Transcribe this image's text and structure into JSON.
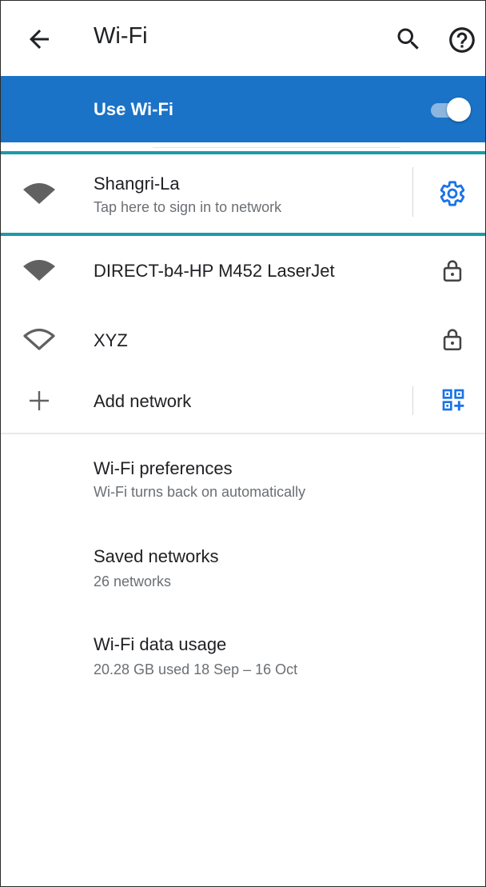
{
  "header": {
    "title": "Wi-Fi"
  },
  "toggle": {
    "label": "Use Wi-Fi",
    "enabled": true
  },
  "networks": [
    {
      "name": "Shangri-La",
      "status": "Tap here to sign in to network",
      "signal_icon": "wifi-full-icon",
      "action_icon": "gear-icon"
    },
    {
      "name": "DIRECT-b4-HP M452 LaserJet",
      "signal_icon": "wifi-full-icon",
      "action_icon": "lock-icon"
    },
    {
      "name": "XYZ",
      "signal_icon": "wifi-outline-icon",
      "action_icon": "lock-icon"
    }
  ],
  "add_network": {
    "label": "Add network",
    "icon": "plus-icon",
    "action_icon": "qr-code-scan-icon"
  },
  "settings": [
    {
      "title": "Wi-Fi preferences",
      "summary": "Wi-Fi turns back on automatically"
    },
    {
      "title": "Saved networks",
      "summary": "26 networks"
    },
    {
      "title": "Wi-Fi data usage",
      "summary": "20.28 GB used 18 Sep – 16 Oct"
    }
  ],
  "colors": {
    "accent": "#1a73c6",
    "highlight": "#1c9aa8",
    "icon_grey": "#616161"
  }
}
